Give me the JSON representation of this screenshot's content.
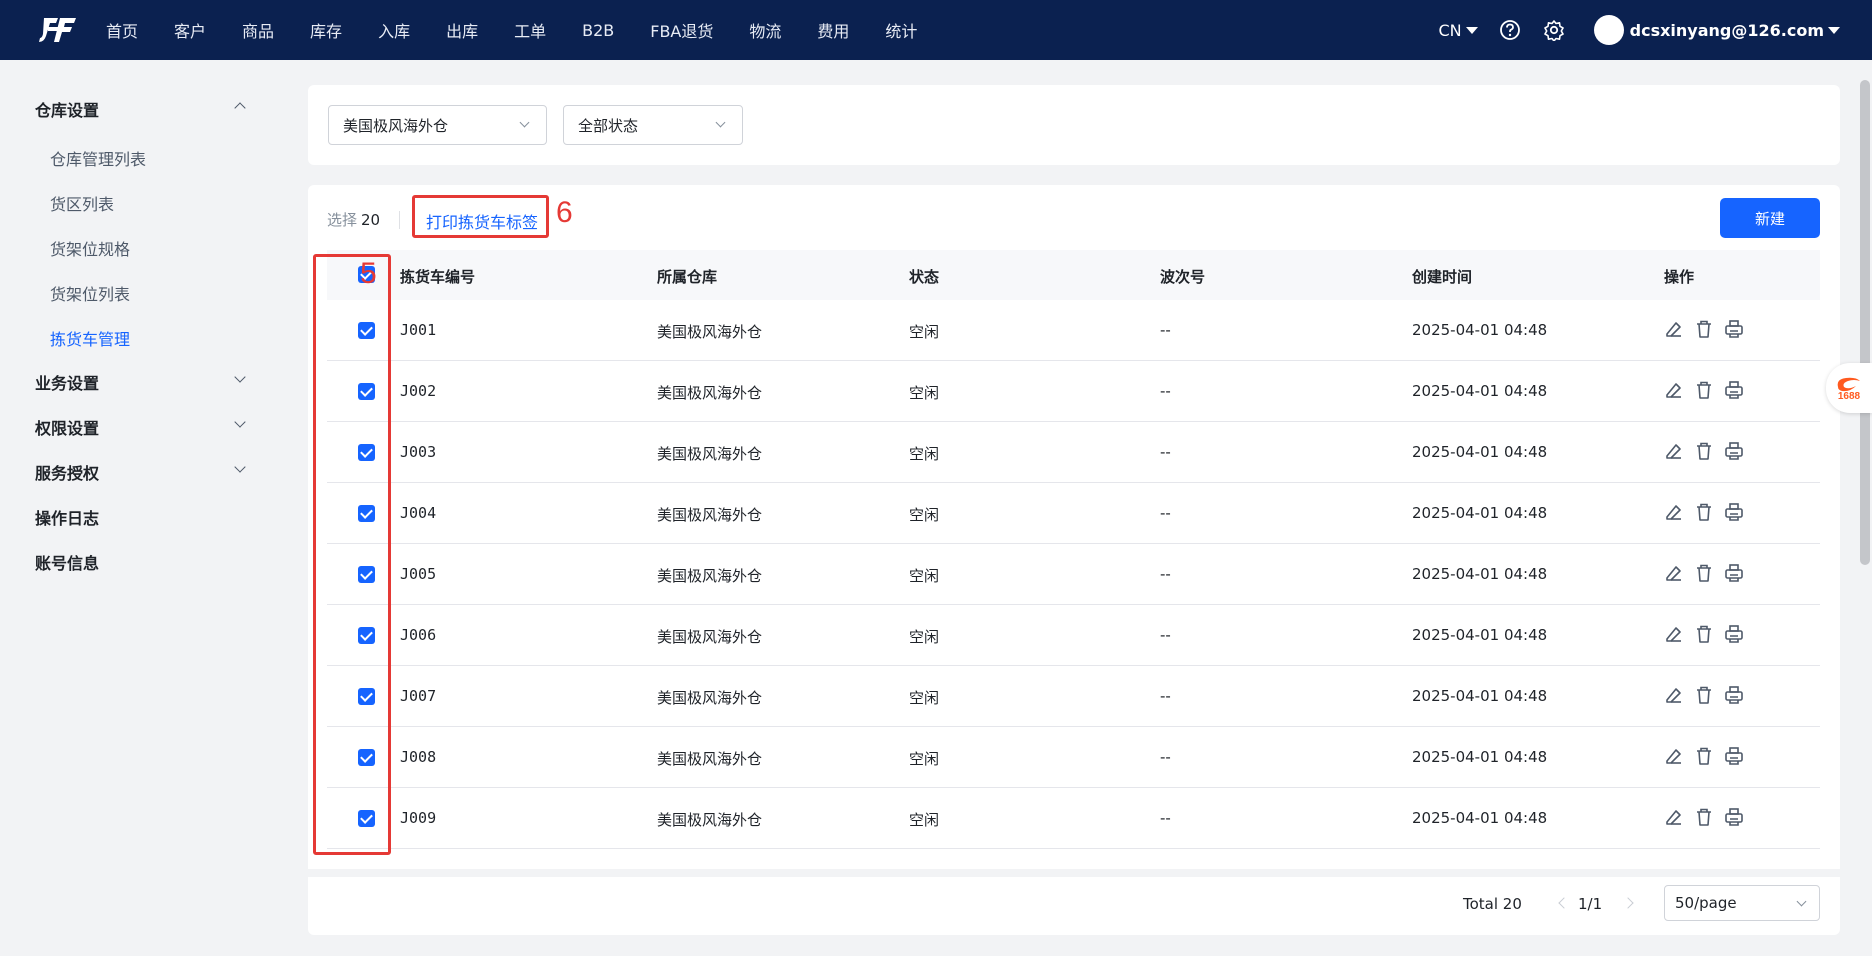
{
  "topbar": {
    "nav": [
      "首页",
      "客户",
      "商品",
      "库存",
      "入库",
      "出库",
      "工单",
      "B2B",
      "FBA退货",
      "物流",
      "费用",
      "统计"
    ],
    "lang": "CN",
    "user_email": "dcsxinyang@126.com"
  },
  "sidebar": {
    "groups": [
      {
        "label": "仓库设置",
        "expanded": true
      },
      {
        "label": "业务设置",
        "expanded": false
      },
      {
        "label": "权限设置",
        "expanded": false
      },
      {
        "label": "服务授权",
        "expanded": false
      },
      {
        "label": "操作日志"
      },
      {
        "label": "账号信息"
      }
    ],
    "sub_items": [
      "仓库管理列表",
      "货区列表",
      "货架位规格",
      "货架位列表",
      "拣货车管理"
    ],
    "active_sub": "拣货车管理"
  },
  "filters": {
    "warehouse": "美国极风海外仓",
    "status": "全部状态"
  },
  "toolbar": {
    "selected_label": "选择",
    "selected_count": "20",
    "print_label": "打印拣货车标签",
    "new_label": "新建"
  },
  "table": {
    "columns": [
      "拣货车编号",
      "所属仓库",
      "状态",
      "波次号",
      "创建时间",
      "操作"
    ],
    "rows": [
      {
        "code": "J001",
        "warehouse": "美国极风海外仓",
        "status": "空闲",
        "wave": "--",
        "created": "2025-04-01 04:48"
      },
      {
        "code": "J002",
        "warehouse": "美国极风海外仓",
        "status": "空闲",
        "wave": "--",
        "created": "2025-04-01 04:48"
      },
      {
        "code": "J003",
        "warehouse": "美国极风海外仓",
        "status": "空闲",
        "wave": "--",
        "created": "2025-04-01 04:48"
      },
      {
        "code": "J004",
        "warehouse": "美国极风海外仓",
        "status": "空闲",
        "wave": "--",
        "created": "2025-04-01 04:48"
      },
      {
        "code": "J005",
        "warehouse": "美国极风海外仓",
        "status": "空闲",
        "wave": "--",
        "created": "2025-04-01 04:48"
      },
      {
        "code": "J006",
        "warehouse": "美国极风海外仓",
        "status": "空闲",
        "wave": "--",
        "created": "2025-04-01 04:48"
      },
      {
        "code": "J007",
        "warehouse": "美国极风海外仓",
        "status": "空闲",
        "wave": "--",
        "created": "2025-04-01 04:48"
      },
      {
        "code": "J008",
        "warehouse": "美国极风海外仓",
        "status": "空闲",
        "wave": "--",
        "created": "2025-04-01 04:48"
      },
      {
        "code": "J009",
        "warehouse": "美国极风海外仓",
        "status": "空闲",
        "wave": "--",
        "created": "2025-04-01 04:48"
      }
    ],
    "row_actions": [
      "edit-icon",
      "delete-icon",
      "print-icon"
    ]
  },
  "pagination": {
    "total": "Total 20",
    "page": "1/1",
    "page_size": "50/page"
  },
  "annotations": {
    "checkbox_column_number": "5",
    "print_button_number": "6",
    "color": "#e53935"
  },
  "float_badge": "1688",
  "colors": {
    "topbar": "#0b2150",
    "primary": "#1664ff",
    "annotation": "#e53935"
  }
}
